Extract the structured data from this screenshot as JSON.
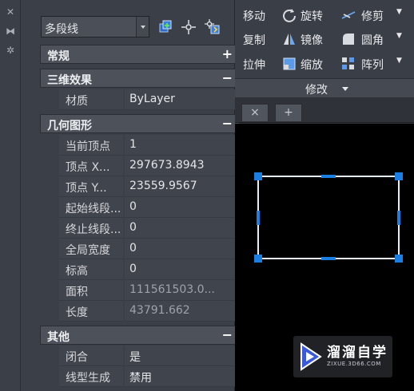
{
  "panel": {
    "object_type": "多段线",
    "sections": [
      {
        "title": "常规",
        "toggle": "+"
      },
      {
        "title": "三维效果",
        "toggle": "−"
      },
      {
        "title": "几何图形",
        "toggle": "−"
      },
      {
        "title": "其他",
        "toggle": "−"
      }
    ],
    "rows": [
      {
        "label": "材质",
        "value": "ByLayer"
      },
      {
        "label": "当前顶点",
        "value": "1"
      },
      {
        "label": "顶点 X...",
        "value": "297673.8943"
      },
      {
        "label": "顶点 Y...",
        "value": "23559.9567"
      },
      {
        "label": "起始线段...",
        "value": "0"
      },
      {
        "label": "终止线段...",
        "value": "0"
      },
      {
        "label": "全局宽度",
        "value": "0"
      },
      {
        "label": "标高",
        "value": "0"
      },
      {
        "label": "面积",
        "value": "111561503.0..."
      },
      {
        "label": "长度",
        "value": "43791.662"
      },
      {
        "label": "闭合",
        "value": "是"
      },
      {
        "label": "线型生成",
        "value": "禁用"
      }
    ]
  },
  "ribbon": {
    "buttons": [
      {
        "label": "移动",
        "icon": "move-icon"
      },
      {
        "label": "旋转",
        "icon": "rotate-icon"
      },
      {
        "label": "修剪",
        "icon": "trim-icon"
      },
      {
        "label": "复制",
        "icon": "copy-icon"
      },
      {
        "label": "镜像",
        "icon": "mirror-icon"
      },
      {
        "label": "圆角",
        "icon": "fillet-icon"
      },
      {
        "label": "拉伸",
        "icon": "stretch-icon"
      },
      {
        "label": "缩放",
        "icon": "scale-icon"
      },
      {
        "label": "阵列",
        "icon": "array-icon"
      }
    ],
    "panel_label": "修改"
  },
  "tabs": [
    {
      "label": "×"
    },
    {
      "label": "+"
    }
  ],
  "watermark": {
    "text": "溜溜自学",
    "sub": "ZIXUE.3D66.COM"
  },
  "colors": {
    "accent": "#1a7fe0",
    "selection_line": "#e8eef8"
  }
}
